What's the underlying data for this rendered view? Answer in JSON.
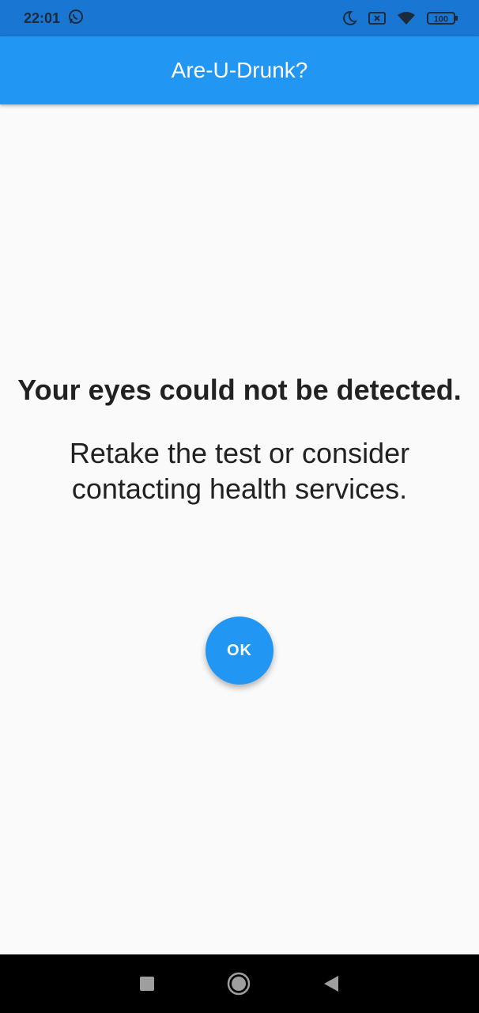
{
  "status_bar": {
    "time": "22:01",
    "battery": "100",
    "icons": [
      "whatsapp-icon",
      "moon-icon",
      "sim-x-icon",
      "wifi-icon",
      "battery-icon"
    ]
  },
  "app_bar": {
    "title": "Are-U-Drunk?"
  },
  "main": {
    "heading": "Your eyes could not be detected.",
    "message": "Retake the test or consider contacting health services.",
    "ok_label": "OK"
  },
  "nav_bar": {
    "icons": [
      "recents-square-icon",
      "home-circle-icon",
      "back-triangle-icon"
    ]
  },
  "colors": {
    "primary": "#2196f3",
    "status_bar": "#1976d2",
    "background": "#fafafa",
    "text": "#212121"
  }
}
